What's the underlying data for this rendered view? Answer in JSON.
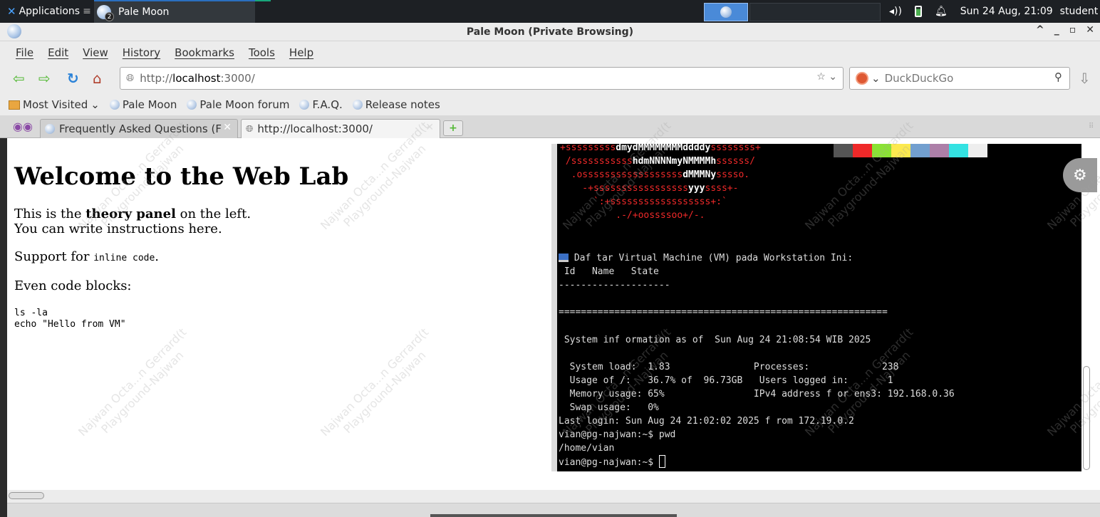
{
  "panel": {
    "applications_label": "Applications",
    "task_label": "Pale Moon",
    "task_count": "2",
    "clock": "Sun 24 Aug, 21:09",
    "user": "student"
  },
  "window": {
    "title": "Pale Moon (Private Browsing)",
    "controls": [
      "^",
      "_",
      "▫",
      "✕"
    ]
  },
  "menu": [
    "File",
    "Edit",
    "View",
    "History",
    "Bookmarks",
    "Tools",
    "Help"
  ],
  "nav": {
    "url_prefix": "http://",
    "url_host": "localhost",
    "url_suffix": ":3000/",
    "search_placeholder": "DuckDuckGo"
  },
  "bookmarks": {
    "most_visited": "Most Visited",
    "items": [
      "Pale Moon",
      "Pale Moon forum",
      "F.A.Q.",
      "Release notes"
    ]
  },
  "tabs": [
    {
      "label": "Frequently Asked Questions (F",
      "active": false
    },
    {
      "label": "http://localhost:3000/",
      "active": true
    }
  ],
  "page": {
    "heading": "Welcome to the Web Lab",
    "p1_pre": "This is the ",
    "p1_bold": "theory panel",
    "p1_post": " on the left.",
    "p1_line2": "You can write instructions here.",
    "p2_pre": "Support for ",
    "p2_code": "inline code",
    "p2_post": ".",
    "p3": "Even code blocks:",
    "code_block": "ls -la\necho \"Hello from VM\""
  },
  "terminal": {
    "art": [
      {
        "red1": "+sssssssss",
        "wht": "dmydMMMMMMMMddddy",
        "red2": "ssssssss+"
      },
      {
        "red1": " /sssssssssss",
        "wht": "hdmNNNNmyNMMMMh",
        "red2": "ssssss/"
      },
      {
        "red1": "  .ossssssssssssssssss",
        "wht": "dMMMNy",
        "red2": "sssso."
      },
      {
        "red1": "    -+sssssssssssssssss",
        "wht": "yyy",
        "red2": "ssss+-"
      },
      {
        "red1": "      `:+ssssssssssssssssss+:`",
        "wht": "",
        "red2": ""
      },
      {
        "red1": "          .-/+oossssoo+/-.",
        "wht": "",
        "red2": ""
      }
    ],
    "swatch_colors": [
      "#555555",
      "#ef2929",
      "#8ae234",
      "#fce94f",
      "#729fcf",
      "#ad7fa8",
      "#34e2e2",
      "#eeeeee"
    ],
    "vm_title": " Daf tar Virtual Machine (VM) pada Workstation Ini:",
    "table_header": " Id   Name   State",
    "dash_line": "--------------------",
    "eq_line": "===========================================================",
    "sysinfo": " System inf ormation as of  Sun Aug 24 21:08:54 WIB 2025",
    "stats": [
      "  System load:  1.83               Processes:             238",
      "  Usage of /:   36.7% of  96.73GB   Users logged in:       1",
      "  Memory usage: 65%                IPv4 address f or ens3: 192.168.0.36",
      "  Swap usage:   0%"
    ],
    "last_login": "Last login: Sun Aug 24 21:02:02 2025 f rom 172.19.0.2",
    "prompt1": "vian@pg-najwan:~$ pwd",
    "output1": "/home/vian",
    "prompt2": "vian@pg-najwan:~$ "
  },
  "watermark": {
    "line1": "Najwan Octa...n Gerrard(t",
    "line2": "Playground-Najwan"
  }
}
